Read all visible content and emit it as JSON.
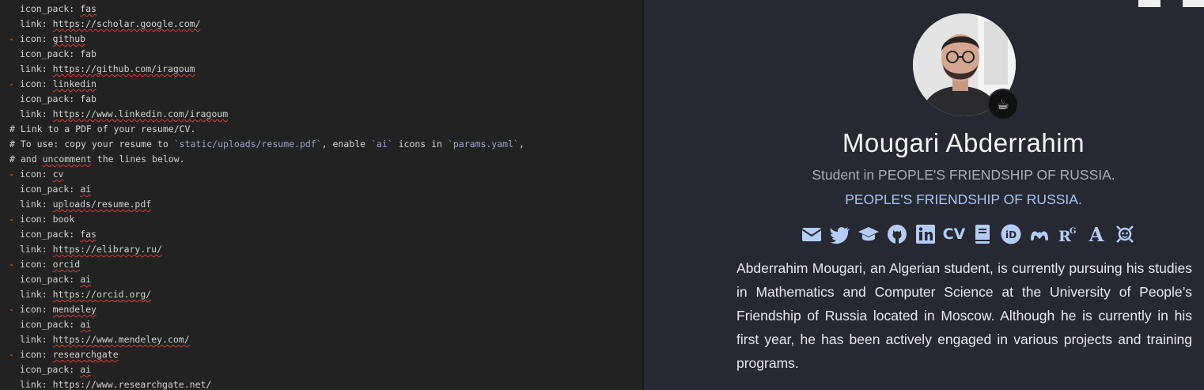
{
  "editor": {
    "lines": [
      {
        "kind": "field",
        "key": "icon_pack:",
        "value": "fas",
        "squiggle": true
      },
      {
        "kind": "field",
        "key": "link:",
        "value": "https://scholar.google.com/",
        "squiggle": true
      },
      {
        "kind": "item",
        "key": "icon:",
        "value": "github",
        "squiggle": true
      },
      {
        "kind": "field",
        "key": "icon_pack:",
        "value": "fab",
        "squiggle": false
      },
      {
        "kind": "field",
        "key": "link:",
        "value": "https://github.com/iragoum",
        "squiggle": true
      },
      {
        "kind": "item",
        "key": "icon:",
        "value": "linkedin",
        "squiggle": true
      },
      {
        "kind": "field",
        "key": "icon_pack:",
        "value": "fab",
        "squiggle": false
      },
      {
        "kind": "field",
        "key": "link:",
        "value": "https://www.linkedin.com/iragoum",
        "squiggle": true
      },
      {
        "kind": "comment",
        "text": "# Link to a PDF of your resume/CV."
      },
      {
        "kind": "comment",
        "text": "# To use: copy your resume to `static/uploads/resume.pdf`, enable `ai` icons in `params.yaml`,"
      },
      {
        "kind": "comment",
        "text": "# and uncomment the lines below."
      },
      {
        "kind": "item",
        "key": "icon:",
        "value": "cv",
        "squiggle": true
      },
      {
        "kind": "field",
        "key": "icon_pack:",
        "value": "ai",
        "squiggle": true
      },
      {
        "kind": "field",
        "key": "link:",
        "value": "uploads/resume.pdf",
        "squiggle": true
      },
      {
        "kind": "item",
        "key": "icon:",
        "value": "book",
        "squiggle": false
      },
      {
        "kind": "field",
        "key": "icon_pack:",
        "value": "fas",
        "squiggle": true
      },
      {
        "kind": "field",
        "key": "link:",
        "value": "https://elibrary.ru/",
        "squiggle": true
      },
      {
        "kind": "item",
        "key": "icon:",
        "value": "orcid",
        "squiggle": true
      },
      {
        "kind": "field",
        "key": "icon_pack:",
        "value": "ai",
        "squiggle": true
      },
      {
        "kind": "field",
        "key": "link:",
        "value": "https://orcid.org/",
        "squiggle": true
      },
      {
        "kind": "item",
        "key": "icon:",
        "value": "mendeley",
        "squiggle": true
      },
      {
        "kind": "field",
        "key": "icon_pack:",
        "value": "ai",
        "squiggle": true
      },
      {
        "kind": "field",
        "key": "link:",
        "value": "https://www.mendeley.com/",
        "squiggle": true
      },
      {
        "kind": "item",
        "key": "icon:",
        "value": "researchgate",
        "squiggle": true
      },
      {
        "kind": "field",
        "key": "icon_pack:",
        "value": "ai",
        "squiggle": true
      },
      {
        "kind": "field",
        "key": "link:",
        "value": "https://www.researchgate.net/",
        "squiggle": true
      }
    ]
  },
  "profile": {
    "avatar_icon": "profile-photo",
    "badge_emoji": "☕",
    "name": "Mougari Abderrahim",
    "role": "Student in PEOPLE'S FRIENDSHIP OF RUSSIA.",
    "organization": "PEOPLE'S FRIENDSHIP OF RUSSIA.",
    "bio": "Abderrahim Mougari, an Algerian student, is currently pursuing his studies in Mathematics and Computer Science at the University of People’s Friendship of Russia located in Moscow. Although he is currently in his first year, he has been actively engaged in various projects and training programs."
  },
  "social_icons": [
    {
      "name": "envelope-icon",
      "label": ""
    },
    {
      "name": "twitter-icon",
      "label": ""
    },
    {
      "name": "graduation-cap-icon",
      "label": ""
    },
    {
      "name": "github-icon",
      "label": ""
    },
    {
      "name": "linkedin-icon",
      "label": ""
    },
    {
      "name": "cv-icon",
      "label": "CV"
    },
    {
      "name": "book-icon",
      "label": ""
    },
    {
      "name": "orcid-icon",
      "label": "iD"
    },
    {
      "name": "mendeley-icon",
      "label": ""
    },
    {
      "name": "researchgate-icon",
      "label": "RG"
    },
    {
      "name": "academia-icon",
      "label": "A"
    },
    {
      "name": "publons-icon",
      "label": ""
    }
  ],
  "colors": {
    "accent": "#b3cdf6",
    "yaml_dash": "#e8873a",
    "editor_bg": "#222222",
    "preview_bg": "#262832"
  }
}
